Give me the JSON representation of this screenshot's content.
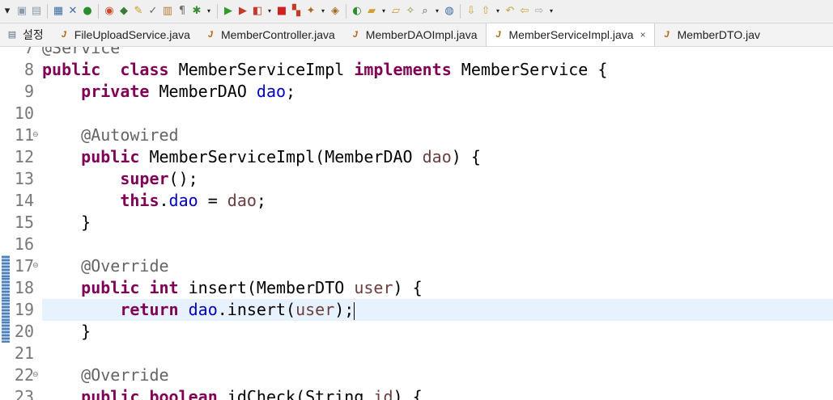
{
  "toolbar": {
    "icons": [
      "chevron-down-icon",
      "save-icon",
      "save-all-icon",
      "print-icon",
      "debug-skip-icon",
      "java-config-icon",
      "ant-icon",
      "external-tools-icon",
      "pen-icon",
      "task-icon",
      "clipboard-icon",
      "show-whitespace-icon",
      "debug-icon",
      "run-icon",
      "run-external-icon",
      "coverage-icon",
      "terminate-icon",
      "build-icon",
      "new-java-icon",
      "new-package-icon",
      "new-class-icon",
      "open-folder-icon",
      "open-type-icon",
      "open-resource-icon",
      "search-icon",
      "globe-icon",
      "next-annotation-icon",
      "previous-annotation-icon",
      "last-edit-icon",
      "back-icon",
      "forward-icon"
    ]
  },
  "tabs": [
    {
      "label": "설정",
      "icon": "document-icon",
      "active": false
    },
    {
      "label": "FileUploadService.java",
      "icon": "java-file-icon",
      "active": false
    },
    {
      "label": "MemberController.java",
      "icon": "java-file-icon",
      "active": false
    },
    {
      "label": "MemberDAOImpl.java",
      "icon": "java-file-icon",
      "active": false
    },
    {
      "label": "MemberServiceImpl.java",
      "icon": "java-file-icon",
      "active": true,
      "close": "×"
    },
    {
      "label": "MemberDTO.jav",
      "icon": "java-file-icon",
      "active": false
    }
  ],
  "editor": {
    "current_line": 19,
    "lines": [
      {
        "n": "7",
        "tokens": [
          [
            "ann",
            "@Service"
          ]
        ]
      },
      {
        "n": "8",
        "tokens": [
          [
            "kw",
            "public"
          ],
          [
            "",
            "  "
          ],
          [
            "kw",
            "class"
          ],
          [
            "",
            " MemberServiceImpl "
          ],
          [
            "kw",
            "implements"
          ],
          [
            "",
            " MemberService {"
          ]
        ]
      },
      {
        "n": "9",
        "tokens": [
          [
            "",
            "    "
          ],
          [
            "kw",
            "private"
          ],
          [
            "",
            " MemberDAO "
          ],
          [
            "fld",
            "dao"
          ],
          [
            "",
            ";"
          ]
        ]
      },
      {
        "n": "10",
        "tokens": []
      },
      {
        "n": "11",
        "fold": "⊖",
        "tokens": [
          [
            "",
            "    "
          ],
          [
            "ann",
            "@Autowired"
          ]
        ]
      },
      {
        "n": "12",
        "tokens": [
          [
            "",
            "    "
          ],
          [
            "kw",
            "public"
          ],
          [
            "",
            " MemberServiceImpl(MemberDAO "
          ],
          [
            "prm",
            "dao"
          ],
          [
            "",
            ") {"
          ]
        ]
      },
      {
        "n": "13",
        "tokens": [
          [
            "",
            "        "
          ],
          [
            "kw",
            "super"
          ],
          [
            "",
            "();"
          ]
        ]
      },
      {
        "n": "14",
        "tokens": [
          [
            "",
            "        "
          ],
          [
            "kw",
            "this"
          ],
          [
            "",
            "."
          ],
          [
            "fld",
            "dao"
          ],
          [
            "",
            " = "
          ],
          [
            "prm",
            "dao"
          ],
          [
            "",
            ";"
          ]
        ]
      },
      {
        "n": "15",
        "tokens": [
          [
            "",
            "    }"
          ]
        ]
      },
      {
        "n": "16",
        "tokens": []
      },
      {
        "n": "17",
        "fold": "⊖",
        "qd": true,
        "tokens": [
          [
            "",
            "    "
          ],
          [
            "ann",
            "@Override"
          ]
        ]
      },
      {
        "n": "18",
        "qd": true,
        "tokens": [
          [
            "",
            "    "
          ],
          [
            "kw",
            "public"
          ],
          [
            "",
            " "
          ],
          [
            "kw",
            "int"
          ],
          [
            "",
            " insert(MemberDTO "
          ],
          [
            "prm",
            "user"
          ],
          [
            "",
            ") {"
          ]
        ]
      },
      {
        "n": "19",
        "qd": true,
        "caret": true,
        "tokens": [
          [
            "",
            "        "
          ],
          [
            "kw",
            "return"
          ],
          [
            "",
            " "
          ],
          [
            "fld",
            "dao"
          ],
          [
            "",
            ".insert("
          ],
          [
            "prm",
            "user"
          ],
          [
            "",
            ");"
          ]
        ]
      },
      {
        "n": "20",
        "qd": true,
        "tokens": [
          [
            "",
            "    }"
          ]
        ]
      },
      {
        "n": "21",
        "tokens": []
      },
      {
        "n": "22",
        "fold": "⊖",
        "tokens": [
          [
            "",
            "    "
          ],
          [
            "ann",
            "@Override"
          ]
        ]
      },
      {
        "n": "23",
        "tokens": [
          [
            "",
            "    "
          ],
          [
            "kw",
            "public"
          ],
          [
            "",
            " "
          ],
          [
            "kw",
            "boolean"
          ],
          [
            "",
            " idCheck(String "
          ],
          [
            "prm",
            "id"
          ],
          [
            "",
            ") {"
          ]
        ]
      }
    ]
  }
}
